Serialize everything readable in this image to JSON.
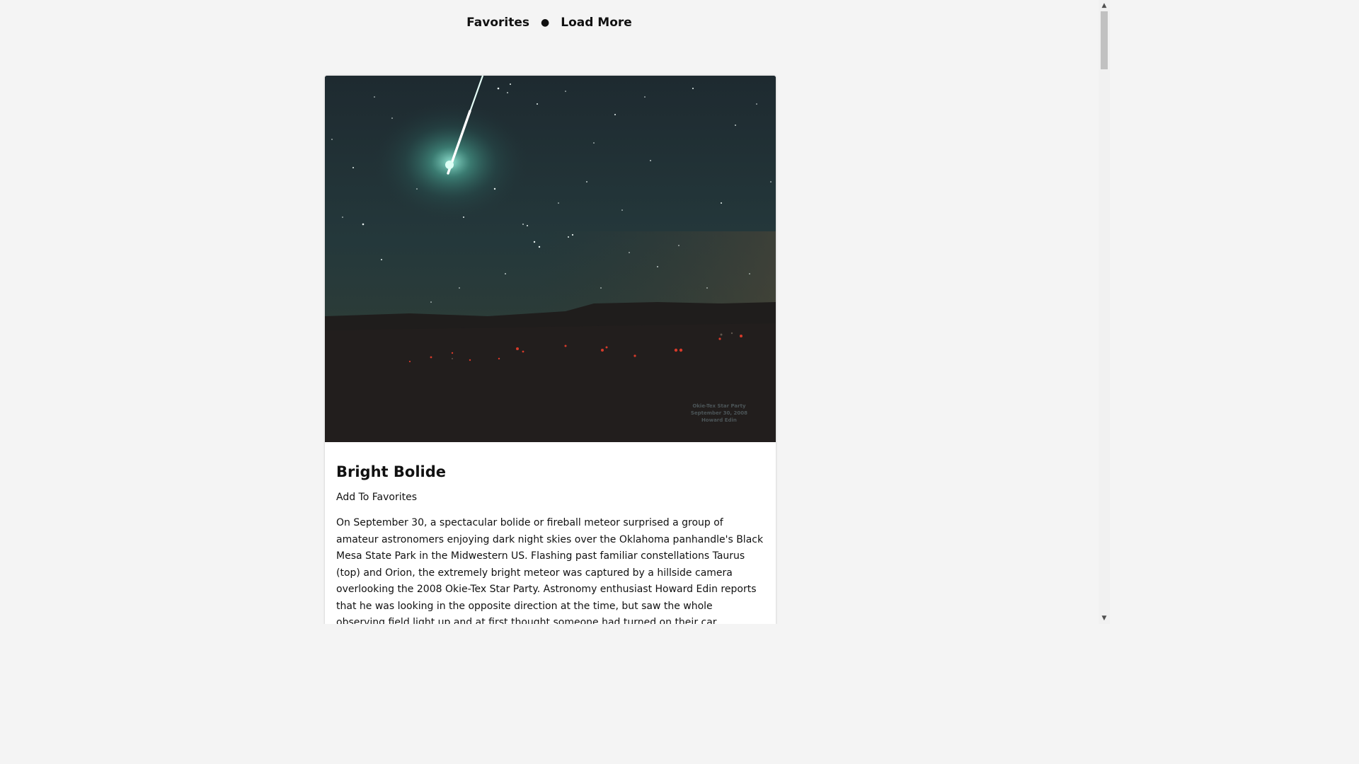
{
  "nav": {
    "favorites": "Favorites",
    "separator": "●",
    "load_more": "Load More"
  },
  "card": {
    "photo": {
      "icon": "bolide-photo",
      "watermark": [
        "Okie-Tex Star Party",
        "September 30, 2008",
        "Howard Edin"
      ]
    },
    "title": "Bright Bolide",
    "favorite_label": "Add To Favorites",
    "explanation": "On September 30, a spectacular bolide or fireball meteor surprised a group of amateur astronomers enjoying dark night skies over the Oklahoma panhandle's Black Mesa State Park in the Midwestern US. Flashing past familiar constellations Taurus (top) and Orion, the extremely bright meteor was captured by a hillside camera overlooking the 2008 Okie-Tex Star Party. Astronomy enthusiast Howard Edin reports that he was looking in the opposite direction at the time, but saw the whole observing field light up and at first thought someone had turned on their car headlights. So far the sighting of a such a bright bolide"
  },
  "scrollbar": {
    "up_arrow": "▲",
    "down_arrow": "▼"
  }
}
